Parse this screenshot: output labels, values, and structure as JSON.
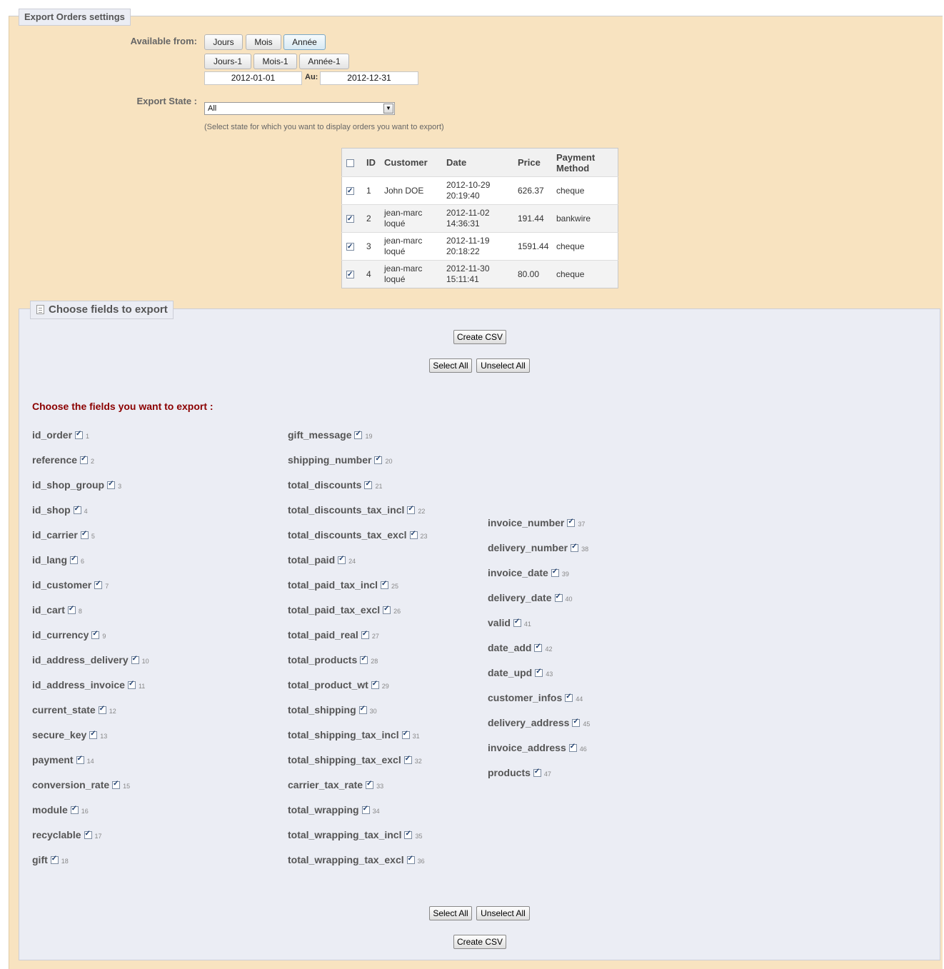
{
  "settings_legend": "Export Orders settings",
  "available_from_label": "Available from:",
  "period_buttons": [
    "Jours",
    "Mois",
    "Année"
  ],
  "period_buttons_prev": [
    "Jours-1",
    "Mois-1",
    "Année-1"
  ],
  "date_from": "2012-01-01",
  "date_to_label": "Au:",
  "date_to": "2012-12-31",
  "export_state_label": "Export State :",
  "export_state_value": "All",
  "export_state_hint": "(Select state for which you want to display orders you want to export)",
  "orders_table": {
    "headers": [
      "ID",
      "Customer",
      "Date",
      "Price",
      "Payment Method"
    ],
    "rows": [
      {
        "id": "1",
        "customer": "John DOE",
        "date": "2012-10-29 20:19:40",
        "price": "626.37",
        "payment": "cheque",
        "checked": true
      },
      {
        "id": "2",
        "customer": "jean-marc loqué",
        "date": "2012-11-02 14:36:31",
        "price": "191.44",
        "payment": "bankwire",
        "checked": true
      },
      {
        "id": "3",
        "customer": "jean-marc loqué",
        "date": "2012-11-19 20:18:22",
        "price": "1591.44",
        "payment": "cheque",
        "checked": true
      },
      {
        "id": "4",
        "customer": "jean-marc loqué",
        "date": "2012-11-30 15:11:41",
        "price": "80.00",
        "payment": "cheque",
        "checked": true
      }
    ]
  },
  "fields_legend": "Choose fields to export",
  "create_csv_label": "Create CSV",
  "select_all_label": "Select All",
  "unselect_all_label": "Unselect All",
  "choose_fields_title": "Choose the fields you want to export :",
  "fields_col1": [
    {
      "name": "id_order",
      "num": "1"
    },
    {
      "name": "reference",
      "num": "2"
    },
    {
      "name": "id_shop_group",
      "num": "3"
    },
    {
      "name": "id_shop",
      "num": "4"
    },
    {
      "name": "id_carrier",
      "num": "5"
    },
    {
      "name": "id_lang",
      "num": "6"
    },
    {
      "name": "id_customer",
      "num": "7"
    },
    {
      "name": "id_cart",
      "num": "8"
    },
    {
      "name": "id_currency",
      "num": "9"
    },
    {
      "name": "id_address_delivery",
      "num": "10"
    },
    {
      "name": "id_address_invoice",
      "num": "11"
    },
    {
      "name": "current_state",
      "num": "12"
    },
    {
      "name": "secure_key",
      "num": "13"
    },
    {
      "name": "payment",
      "num": "14"
    },
    {
      "name": "conversion_rate",
      "num": "15"
    },
    {
      "name": "module",
      "num": "16"
    },
    {
      "name": "recyclable",
      "num": "17"
    },
    {
      "name": "gift",
      "num": "18"
    }
  ],
  "fields_col2": [
    {
      "name": "gift_message",
      "num": "19"
    },
    {
      "name": "shipping_number",
      "num": "20"
    },
    {
      "name": "total_discounts",
      "num": "21"
    },
    {
      "name": "total_discounts_tax_incl",
      "num": "22"
    },
    {
      "name": "total_discounts_tax_excl",
      "num": "23"
    },
    {
      "name": "total_paid",
      "num": "24"
    },
    {
      "name": "total_paid_tax_incl",
      "num": "25"
    },
    {
      "name": "total_paid_tax_excl",
      "num": "26"
    },
    {
      "name": "total_paid_real",
      "num": "27"
    },
    {
      "name": "total_products",
      "num": "28"
    },
    {
      "name": "total_product_wt",
      "num": "29"
    },
    {
      "name": "total_shipping",
      "num": "30"
    },
    {
      "name": "total_shipping_tax_incl",
      "num": "31"
    },
    {
      "name": "total_shipping_tax_excl",
      "num": "32"
    },
    {
      "name": "carrier_tax_rate",
      "num": "33"
    },
    {
      "name": "total_wrapping",
      "num": "34"
    },
    {
      "name": "total_wrapping_tax_incl",
      "num": "35"
    },
    {
      "name": "total_wrapping_tax_excl",
      "num": "36"
    }
  ],
  "fields_col3": [
    {
      "name": "invoice_number",
      "num": "37"
    },
    {
      "name": "delivery_number",
      "num": "38"
    },
    {
      "name": "invoice_date",
      "num": "39"
    },
    {
      "name": "delivery_date",
      "num": "40"
    },
    {
      "name": "valid",
      "num": "41"
    },
    {
      "name": "date_add",
      "num": "42"
    },
    {
      "name": "date_upd",
      "num": "43"
    },
    {
      "name": "customer_infos",
      "num": "44"
    },
    {
      "name": "delivery_address",
      "num": "45"
    },
    {
      "name": "invoice_address",
      "num": "46"
    },
    {
      "name": "products",
      "num": "47"
    }
  ]
}
